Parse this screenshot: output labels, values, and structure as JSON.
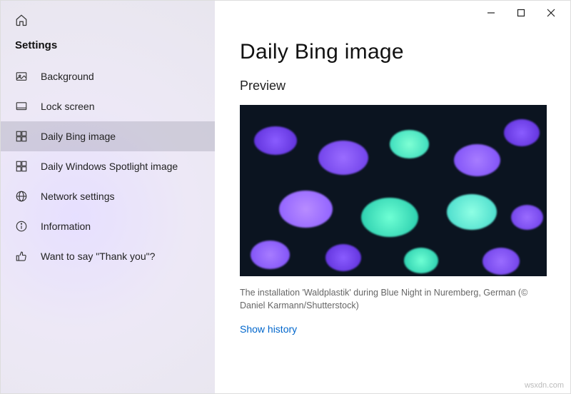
{
  "sidebar": {
    "title": "Settings",
    "items": [
      {
        "label": "Background",
        "icon": "picture-icon"
      },
      {
        "label": "Lock screen",
        "icon": "lock-screen-icon"
      },
      {
        "label": "Daily Bing image",
        "icon": "dashboard-icon"
      },
      {
        "label": "Daily Windows Spotlight image",
        "icon": "spotlight-icon"
      },
      {
        "label": "Network settings",
        "icon": "globe-icon"
      },
      {
        "label": "Information",
        "icon": "info-icon"
      },
      {
        "label": "Want to say \"Thank you\"?",
        "icon": "thumbs-up-icon"
      }
    ]
  },
  "main": {
    "title": "Daily Bing image",
    "preview_label": "Preview",
    "caption": "The installation 'Waldplastik' during Blue Night in Nuremberg, German (© Daniel Karmann/Shutterstock)",
    "history_link": "Show history"
  },
  "watermark": "wsxdn.com"
}
